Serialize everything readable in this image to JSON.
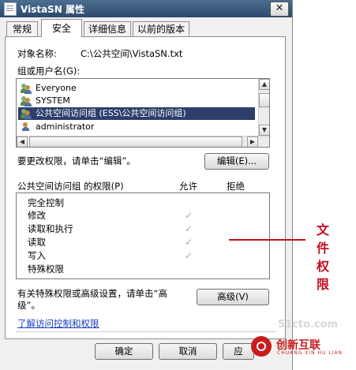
{
  "window": {
    "title": "VistaSN 属性",
    "close_symbol": "✕"
  },
  "tabs": [
    {
      "label": "常规"
    },
    {
      "label": "安全"
    },
    {
      "label": "详细信息"
    },
    {
      "label": "以前的版本"
    }
  ],
  "object": {
    "label": "对象名称:",
    "value": "C:\\公共空间\\VistaSN.txt"
  },
  "users": {
    "label": "组或用户名(G):",
    "items": [
      {
        "name": "Everyone"
      },
      {
        "name": "SYSTEM"
      },
      {
        "name": "公共空间访问组 (ESS\\公共空间访问组)"
      },
      {
        "name": "administrator"
      }
    ],
    "selected_index": 2
  },
  "edit": {
    "hint": "要更改权限，请单击“编辑”。",
    "button": "编辑(E)..."
  },
  "permissions": {
    "header": "公共空间访问组 的权限(P)",
    "allow_header": "允许",
    "deny_header": "拒绝",
    "check_symbol": "✓",
    "items": [
      {
        "name": "完全控制",
        "allow": false
      },
      {
        "name": "修改",
        "allow": true
      },
      {
        "name": "读取和执行",
        "allow": true
      },
      {
        "name": "读取",
        "allow": true
      },
      {
        "name": "写入",
        "allow": true
      },
      {
        "name": "特殊权限",
        "allow": false
      }
    ]
  },
  "advanced": {
    "hint_line1": "有关特殊权限或高级设置，请单击“高",
    "hint_line2": "级”。",
    "button": "高级(V)"
  },
  "link": {
    "text": "了解访问控制和权限"
  },
  "buttons": {
    "ok": "确定",
    "cancel": "取消",
    "apply": "应"
  },
  "annotation": {
    "line1": "文件",
    "line2": "权限",
    "color": "#c20e1e"
  },
  "watermark": {
    "text": "51cto.com",
    "logo_cn": "创新互联",
    "logo_en": "CHUANG XIN HU LIAN"
  }
}
